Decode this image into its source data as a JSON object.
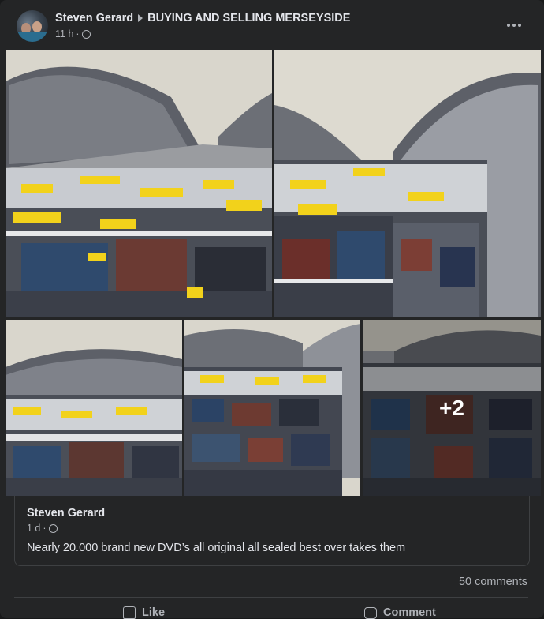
{
  "post": {
    "author": "Steven Gerard",
    "group": "BUYING AND SELLING MERSEYSIDE",
    "time": "11 h",
    "dot": "·"
  },
  "photos": {
    "more_count": "+2"
  },
  "shared_post": {
    "author": "Steven Gerard",
    "time": "1 d",
    "dot": "·",
    "text": "Nearly 20.000 brand new DVD’s all original all sealed best over takes them"
  },
  "footer": {
    "comments": "50 comments",
    "like_label": "Like",
    "comment_label": "Comment"
  },
  "icons": {
    "audience": "globe-icon",
    "separator": "triangle-right-icon",
    "more": "more-options-icon",
    "like": "thumbs-up-icon",
    "comment": "comment-bubble-icon"
  },
  "colors": {
    "background": "#242526",
    "text": "#e4e6eb",
    "secondary_text": "#b0b3b8",
    "tent_canopy": "#d9d6cc",
    "tent_wall": "#6a6d74",
    "dvd_label": "#f2d21b"
  }
}
